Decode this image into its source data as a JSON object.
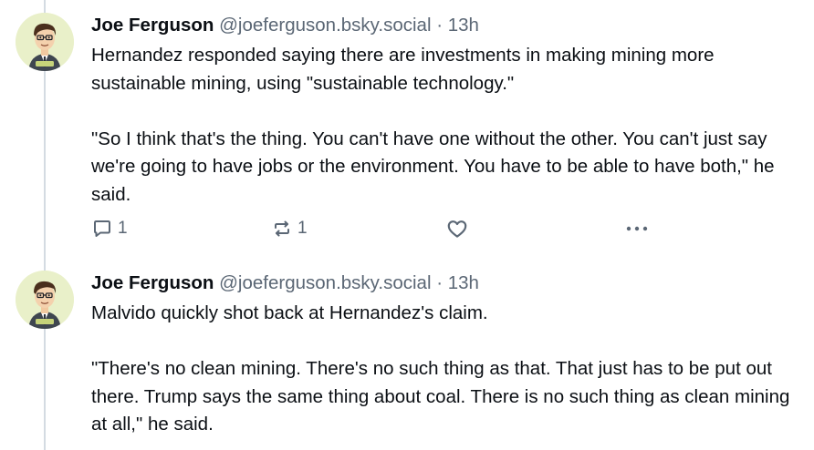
{
  "posts": [
    {
      "author": {
        "display_name": "Joe Ferguson",
        "handle": "@joeferguson.bsky.social"
      },
      "separator": "·",
      "time": "13h",
      "paragraphs": [
        "Hernandez responded saying there are investments in making mining more sustainable mining, using \"sustainable technology.\"",
        "\"So I think that's the thing. You can't have one without the other. You can't just say we're going to have jobs or the environment. You have to be able to have both,\" he said."
      ],
      "reply_count": "1",
      "repost_count": "1",
      "icons": {
        "reply": "reply-icon",
        "repost": "repost-icon",
        "like": "heart-icon",
        "more": "more-icon"
      }
    },
    {
      "author": {
        "display_name": "Joe Ferguson",
        "handle": "@joeferguson.bsky.social"
      },
      "separator": "·",
      "time": "13h",
      "paragraphs": [
        "Malvido quickly shot back at Hernandez's claim.",
        "\"There's no clean mining. There's no such thing as that. That just has to be put out there. Trump says the same thing about coal. There is no such thing as clean mining at all,\" he said."
      ]
    }
  ],
  "colors": {
    "text": "#0b0f14",
    "muted": "#5b6775",
    "thread_line": "#d4dbe2",
    "avatar_background": "#e9f0c9"
  }
}
